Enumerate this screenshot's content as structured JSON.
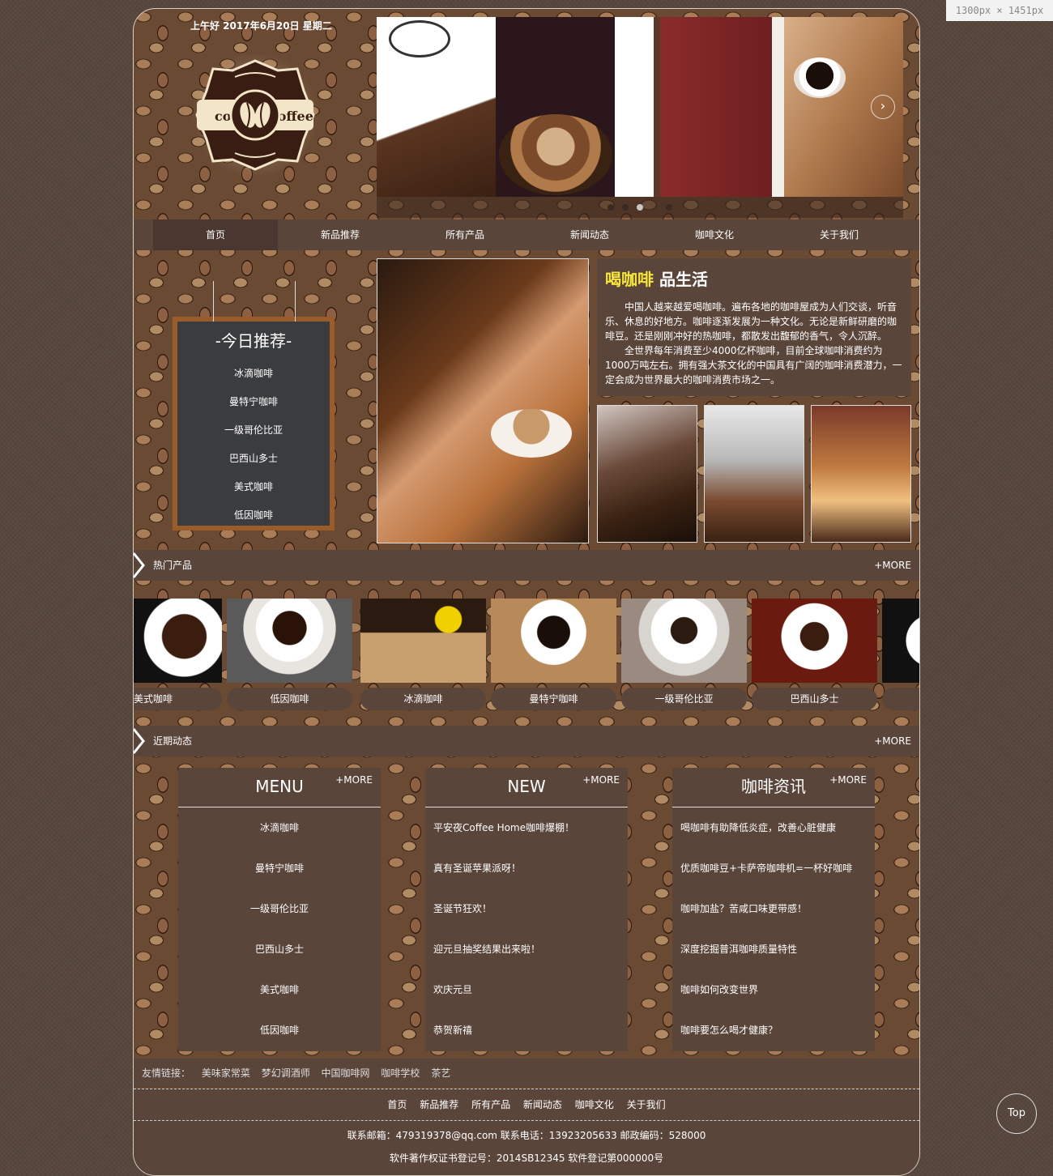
{
  "browser_badge": "1300px × 1451px",
  "header": {
    "greeting": "上午好 2017年6月20日 星期二",
    "logo_text": "coffee"
  },
  "banner": {
    "active_slide": 3,
    "slide_count": 4,
    "next_arrow": "chevron-right-icon"
  },
  "nav": {
    "items": [
      {
        "label": "首页",
        "active": true
      },
      {
        "label": "新品推荐"
      },
      {
        "label": "所有产品"
      },
      {
        "label": "新闻动态"
      },
      {
        "label": "咖啡文化"
      },
      {
        "label": "关于我们"
      }
    ]
  },
  "today": {
    "title": "-今日推荐-",
    "items": [
      "冰滴咖啡",
      "曼特宁咖啡",
      "一级哥伦比亚",
      "巴西山多士",
      "美式咖啡",
      "低因咖啡"
    ]
  },
  "intro": {
    "title_highlight": "喝咖啡",
    "title_rest": "品生活",
    "p1": "中国人越来越爱喝咖啡。遍布各地的咖啡屋成为人们交谈，听音乐、休息的好地方。咖啡逐渐发展为一种文化。无论是新鲜研磨的咖啡豆。还是刚刚冲好的热咖啡，都散发出馥郁的香气，令人沉醉。",
    "p2": "全世界每年消费至少4000亿杯咖啡，目前全球咖啡消费约为1000万吨左右。拥有强大茶文化的中国具有广阔的咖啡消费潜力，一定会成为世界最大的咖啡消费市场之一。"
  },
  "hot": {
    "title": "热门产品",
    "more": "+MORE"
  },
  "products": [
    "美式咖啡",
    "低因咖啡",
    "冰滴咖啡",
    "曼特宁咖啡",
    "一级哥伦比亚",
    "巴西山多士",
    ""
  ],
  "recent": {
    "title": "近期动态",
    "more": "+MORE"
  },
  "boxes": {
    "menu": {
      "title": "MENU",
      "more": "+MORE",
      "items": [
        "冰滴咖啡",
        "曼特宁咖啡",
        "一级哥伦比亚",
        "巴西山多士",
        "美式咖啡",
        "低因咖啡"
      ]
    },
    "new": {
      "title": "NEW",
      "more": "+MORE",
      "items": [
        "平安夜Coffee Home咖啡爆棚！",
        "真有圣诞苹果派呀！",
        "圣诞节狂欢！",
        "迎元旦抽奖结果出来啦！",
        "欢庆元旦",
        "恭贺新禧"
      ]
    },
    "info": {
      "title": "咖啡资讯",
      "more": "+MORE",
      "items": [
        "喝咖啡有助降低炎症，改善心脏健康",
        "优质咖啡豆+卡萨帝咖啡机=一杯好咖啡",
        "咖啡加盐？苦咸口味更带感！",
        "深度挖掘普洱咖啡质量特性",
        "咖啡如何改变世界",
        "咖啡要怎么喝才健康？"
      ]
    }
  },
  "friends": {
    "label": "友情链接：",
    "links": [
      "美味家常菜",
      "梦幻调酒师",
      "中国咖啡网",
      "咖啡学校",
      "茶艺"
    ]
  },
  "footer": {
    "nav": [
      "首页",
      "新品推荐",
      "所有产品",
      "新闻动态",
      "咖啡文化",
      "关于我们"
    ],
    "contact": "联系邮箱：479319378@qq.com 联系电话：13923205633 邮政编码：528000",
    "copyright": "软件著作权证书登记号：2014SB12345 软件登记第000000号"
  },
  "top_button": "Top"
}
